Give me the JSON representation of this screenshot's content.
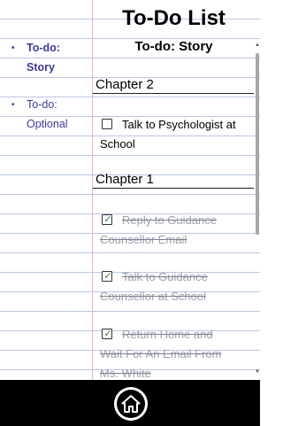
{
  "title": "To-Do List",
  "sidebar": {
    "items": [
      {
        "bullet": "•",
        "line1": "To-do:",
        "line2": "Story"
      },
      {
        "bullet": "•",
        "line1": "To-do:",
        "line2": "Optional"
      }
    ]
  },
  "list": {
    "header": "To-do: Story",
    "chapters": [
      {
        "label": "Chapter 2",
        "tasks": [
          {
            "lines": [
              "Talk to Psychologist at",
              "School"
            ],
            "done": false
          }
        ]
      },
      {
        "label": "Chapter 1",
        "tasks": [
          {
            "lines": [
              "Reply to Guidance",
              "Counsellor Email"
            ],
            "done": true
          },
          {
            "lines": [
              "Talk to Guidance",
              "Counsellor at School"
            ],
            "done": true
          },
          {
            "lines": [
              "Return Home and",
              "Wait For An Email From",
              "Ms. White"
            ],
            "done": true
          }
        ]
      }
    ]
  },
  "check_mark": "✓",
  "colors": {
    "sidebar_text": "#3a3aa6",
    "ruled_line": "#b9c6ea",
    "margin_line": "#e6b7c9",
    "done_text": "#9aa0ac",
    "check": "#2e7d32",
    "bottom_bar": "#000000"
  },
  "icons": {
    "home": "home-icon",
    "scroll_up": "triangle-up-icon",
    "scroll_down": "triangle-down-icon"
  }
}
